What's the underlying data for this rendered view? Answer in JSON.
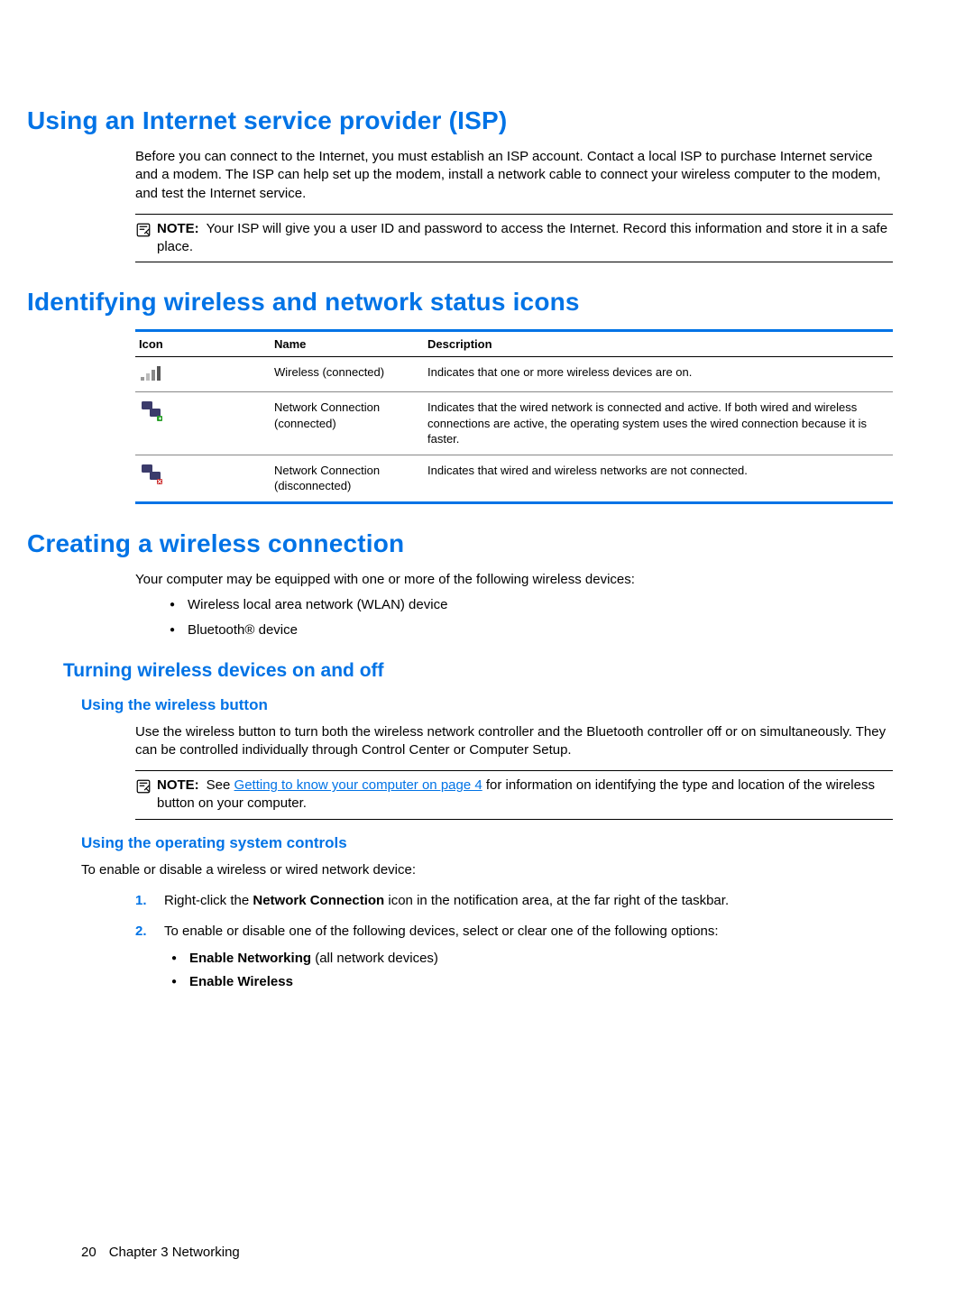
{
  "section1": {
    "title": "Using an Internet service provider (ISP)",
    "para": "Before you can connect to the Internet, you must establish an ISP account. Contact a local ISP to purchase Internet service and a modem. The ISP can help set up the modem, install a network cable to connect your wireless computer to the modem, and test the Internet service.",
    "note_label": "NOTE:",
    "note_text": "Your ISP will give you a user ID and password to access the Internet. Record this information and store it in a safe place."
  },
  "section2": {
    "title": "Identifying wireless and network status icons",
    "table": {
      "headers": {
        "icon": "Icon",
        "name": "Name",
        "desc": "Description"
      },
      "rows": [
        {
          "icon": "wireless-icon",
          "name": "Wireless (connected)",
          "desc": "Indicates that one or more wireless devices are on."
        },
        {
          "icon": "network-connected-icon",
          "name": "Network Connection (connected)",
          "desc": "Indicates that the wired network is connected and active. If both wired and wireless connections are active, the operating system uses the wired connection because it is faster."
        },
        {
          "icon": "network-disconnected-icon",
          "name": "Network Connection (disconnected)",
          "desc": "Indicates that wired and wireless networks are not connected."
        }
      ]
    }
  },
  "section3": {
    "title": "Creating a wireless connection",
    "para": "Your computer may be equipped with one or more of the following wireless devices:",
    "bullets": [
      "Wireless local area network (WLAN) device",
      "Bluetooth® device"
    ],
    "sub1": {
      "title": "Turning wireless devices on and off",
      "h3a": "Using the wireless button",
      "h3a_para": "Use the wireless button to turn both the wireless network controller and the Bluetooth controller off or on simultaneously. They can be controlled individually through Control Center or Computer Setup.",
      "note_label": "NOTE:",
      "note_pre": "See ",
      "note_link": "Getting to know your computer on page 4",
      "note_post": " for information on identifying the type and location of the wireless button on your computer.",
      "h3b": "Using the operating system controls",
      "h3b_para": "To enable or disable a wireless or wired network device:",
      "steps": [
        {
          "pre": "Right-click the ",
          "bold": "Network Connection",
          "post": " icon in the notification area, at the far right of the taskbar."
        },
        {
          "pre": "To enable or disable one of the following devices, select or clear one of the following options:",
          "bold": "",
          "post": "",
          "sub_bullets": [
            {
              "bold": "Enable Networking",
              "rest": " (all network devices)"
            },
            {
              "bold": "Enable Wireless",
              "rest": ""
            }
          ]
        }
      ]
    }
  },
  "footer": {
    "page_num": "20",
    "chapter": "Chapter 3   Networking"
  }
}
